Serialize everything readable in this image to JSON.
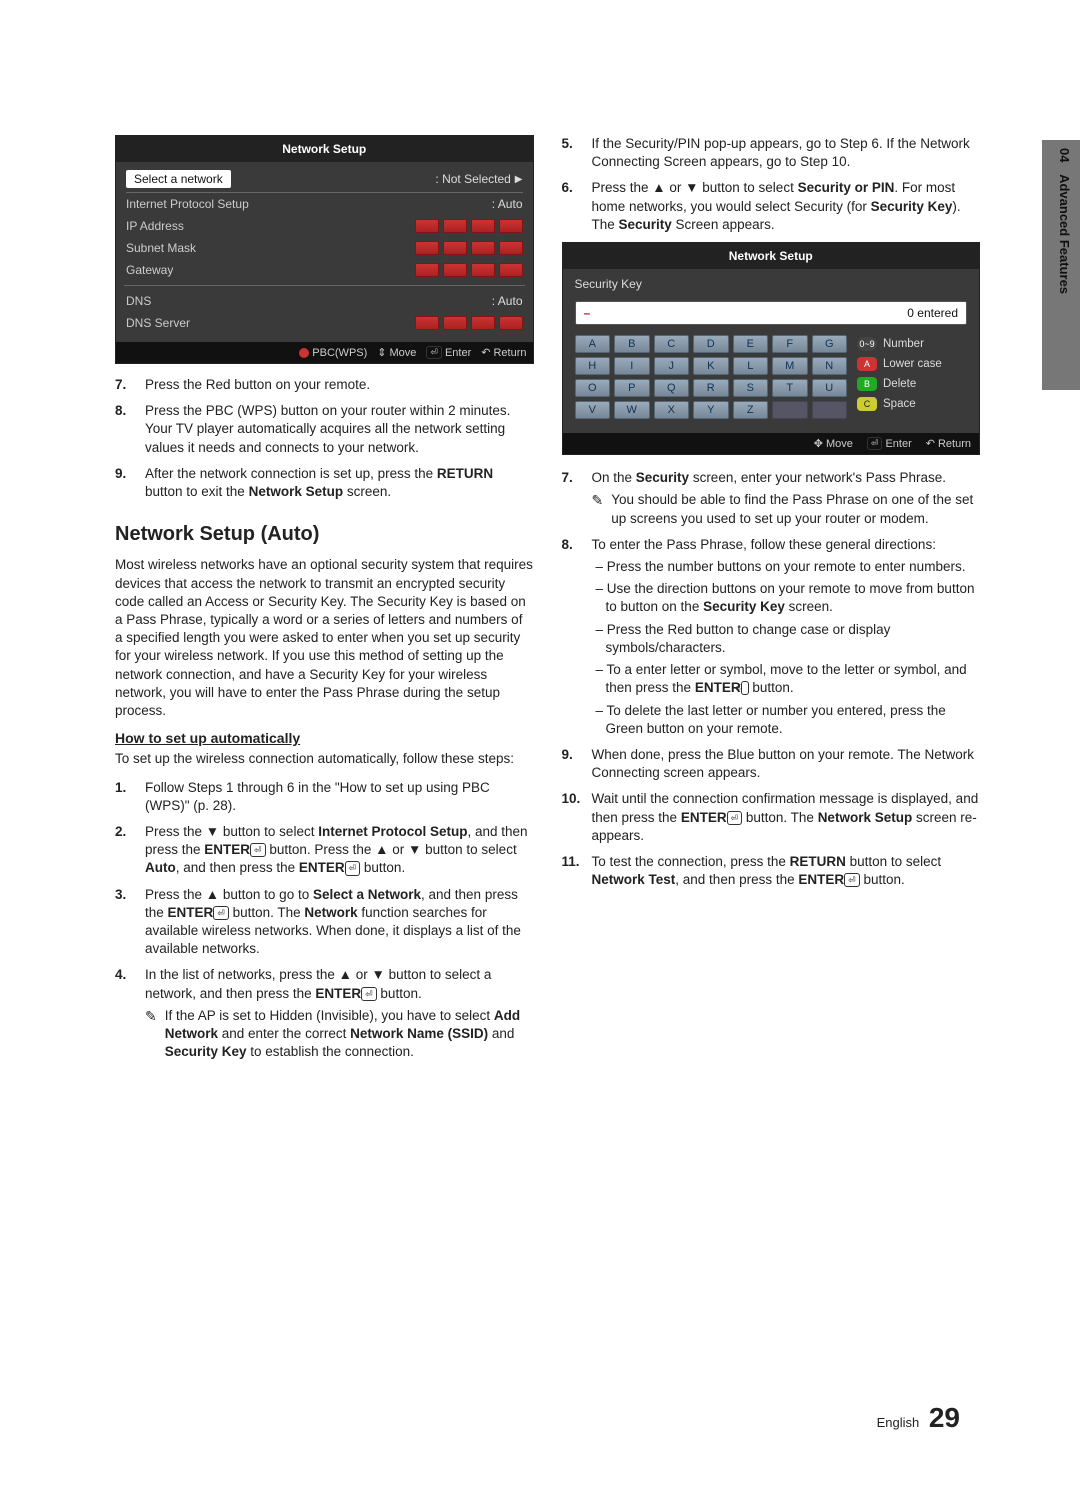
{
  "side": {
    "chapter": "04",
    "title": "Advanced Features"
  },
  "panel1": {
    "title": "Network Setup",
    "rows": {
      "select_network": "Select a network",
      "select_network_val": ": Not Selected",
      "internet_protocol": "Internet Protocol Setup",
      "internet_protocol_val": ": Auto",
      "ip_address": "IP Address",
      "subnet_mask": "Subnet Mask",
      "gateway": "Gateway",
      "dns": "DNS",
      "dns_val": ": Auto",
      "dns_server": "DNS Server"
    },
    "footer": {
      "pbc": "PBC(WPS)",
      "move": "Move",
      "enter": "Enter",
      "ret": "Return"
    }
  },
  "left_steps": {
    "s7": "Press the Red button on your remote.",
    "s8": "Press the PBC (WPS) button on your router within 2 minutes. Your TV player automatically acquires all the network setting values it needs and connects to your network.",
    "s9_a": "After the network connection is set up, press the ",
    "s9_b": "RETURN",
    "s9_c": " button to exit the ",
    "s9_d": "Network Setup",
    "s9_e": " screen."
  },
  "heading_auto": "Network Setup (Auto)",
  "auto_para": "Most wireless networks have an optional security system that requires devices that access the network to transmit an encrypted security code called an Access or Security Key. The Security Key is based on a Pass Phrase, typically a word or a series of letters and numbers of a specified length you were asked to enter when you set up security for your wireless network.  If you use this method of setting up the network connection, and have a Security Key for your wireless network, you will have to enter the Pass Phrase during the setup process.",
  "howto_auto": "How to set up automatically",
  "auto_intro": "To set up the wireless connection automatically, follow these steps:",
  "auto_steps": {
    "s1": "Follow Steps 1 through 6 in the \"How to set up using PBC (WPS)\" (p. 28).",
    "s2_a": "Press the ▼ button to select ",
    "s2_b": "Internet Protocol Setup",
    "s2_c": ", and then press the ",
    "s2_d": "ENTER",
    "s2_e": " button. Press the ▲ or ▼ button to select ",
    "s2_f": "Auto",
    "s2_g": ", and then press the ",
    "s2_h": "ENTER",
    "s2_i": " button.",
    "s3_a": "Press the ▲ button to go to ",
    "s3_b": "Select a Network",
    "s3_c": ", and then press the ",
    "s3_d": "ENTER",
    "s3_e": " button. The ",
    "s3_f": "Network",
    "s3_g": " function searches for available wireless networks. When done, it displays a list of the available networks.",
    "s4_a": "In the list of networks, press the ▲ or ▼ button to select a network, and then press the ",
    "s4_b": "ENTER",
    "s4_c": " button.",
    "note_a": "If the AP is set to Hidden (Invisible), you have to select ",
    "note_b": "Add Network",
    "note_c": " and enter the correct ",
    "note_d": "Network Name (SSID)",
    "note_e": " and ",
    "note_f": "Security Key",
    "note_g": " to establish the connection."
  },
  "right_steps_top": {
    "s5": "If the Security/PIN pop-up appears, go to Step 6. If the Network Connecting Screen appears, go to Step 10.",
    "s6_a": "Press the ▲ or ▼ button to select ",
    "s6_b": "Security or PIN",
    "s6_c": ". For most home networks, you would select Security (for ",
    "s6_d": "Security Key",
    "s6_e": "). The ",
    "s6_f": "Security",
    "s6_g": " Screen appears."
  },
  "kb": {
    "title": "Network Setup",
    "label": "Security Key",
    "cursor": "–",
    "entered": "0 entered",
    "rows": [
      [
        "A",
        "B",
        "C",
        "D",
        "E",
        "F",
        "G"
      ],
      [
        "H",
        "I",
        "J",
        "K",
        "L",
        "M",
        "N"
      ],
      [
        "O",
        "P",
        "Q",
        "R",
        "S",
        "T",
        "U"
      ],
      [
        "V",
        "W",
        "X",
        "Y",
        "Z",
        "",
        ""
      ]
    ],
    "legend": {
      "number": "Number",
      "num_badge": "0~9",
      "lower": "Lower case",
      "del": "Delete",
      "space": "Space"
    },
    "footer": {
      "move": "Move",
      "enter": "Enter",
      "ret": "Return"
    }
  },
  "right_steps_bottom": {
    "s7_a": "On the ",
    "s7_b": "Security",
    "s7_c": " screen, enter your network's Pass Phrase.",
    "note7": "You should be able to find the Pass Phrase on one of the set up screens you used to set up your router or modem.",
    "s8_intro": "To enter the Pass Phrase, follow these general directions:",
    "d1": "Press the number buttons on your remote to enter numbers.",
    "d2_a": "Use the direction buttons on your remote to move from button to button on the ",
    "d2_b": "Security Key",
    "d2_c": " screen.",
    "d3": "Press the Red button to change case or display symbols/characters.",
    "d4_a": "To a enter letter or symbol, move to the letter or symbol, and then press the ",
    "d4_b": "ENTER",
    "d4_c": " button.",
    "d5": "To delete the last letter or number you entered, press the Green button on your remote.",
    "s9": "When done, press the Blue button on your remote. The Network Connecting screen appears.",
    "s10_a": "Wait until the connection confirmation message is displayed, and then press the ",
    "s10_b": "ENTER",
    "s10_c": " button. The ",
    "s10_d": "Network Setup",
    "s10_e": " screen re-appears.",
    "s11_a": "To test the connection, press the ",
    "s11_b": "RETURN",
    "s11_c": " button to select ",
    "s11_d": "Network Test",
    "s11_e": ", and then press the ",
    "s11_f": "ENTER",
    "s11_g": " button."
  },
  "foot": {
    "lang": "English",
    "page": "29"
  }
}
